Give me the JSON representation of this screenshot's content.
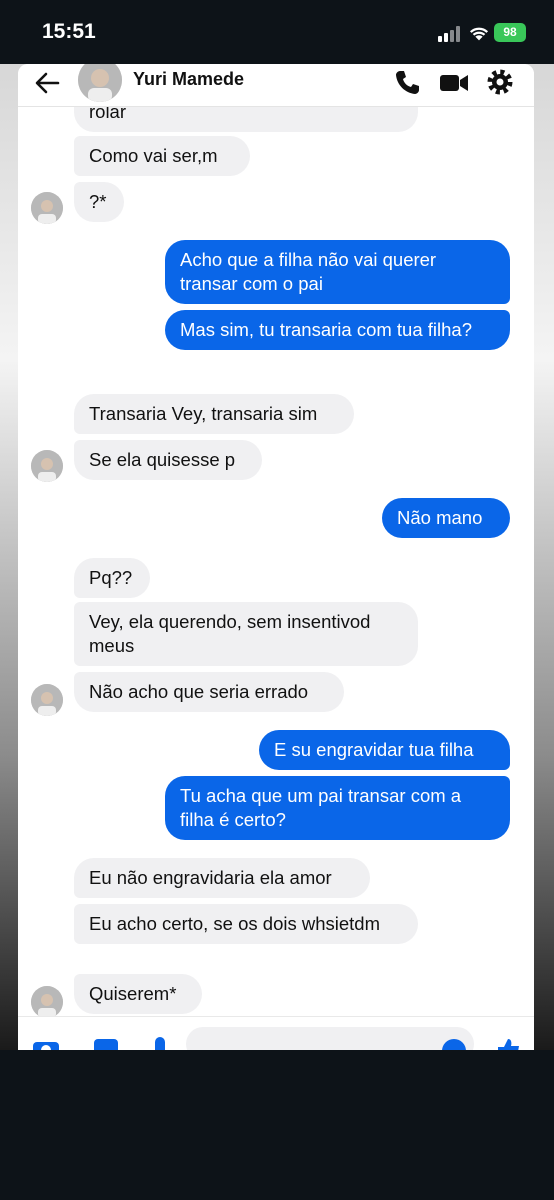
{
  "status": {
    "time": "15:51",
    "battery": "98"
  },
  "header": {
    "contact_name": "Yuri Mamede"
  },
  "messages": [
    {
      "text": "rolar"
    },
    {
      "text": "Como vai ser,m"
    },
    {
      "text": "?*"
    },
    {
      "text": "Acho que a filha não vai querer transar com o pai"
    },
    {
      "text": "Mas sim, tu transaria com tua filha?"
    },
    {
      "text": "Transaria Vey, transaria sim"
    },
    {
      "text": "Se ela quisesse p"
    },
    {
      "text": "Não mano"
    },
    {
      "text": "Pq??"
    },
    {
      "text": "Vey, ela querendo, sem insentivod meus"
    },
    {
      "text": "Não acho que seria errado"
    },
    {
      "text": "E su engravidar tua filha"
    },
    {
      "text": "Tu acha que um pai transar com a filha é certo?"
    },
    {
      "text": "Eu não engravidaria ela amor"
    },
    {
      "text": "Eu acho certo, se os dois whsietdm"
    },
    {
      "text": "Quiserem*"
    }
  ],
  "colors": {
    "outgoing": "#0a66e8",
    "incoming": "#f0f0f2",
    "battery": "#39c759"
  },
  "icons": [
    "back-arrow-icon",
    "phone-icon",
    "video-camera-icon",
    "gear-icon",
    "camera-icon",
    "image-icon",
    "microphone-icon",
    "emoji-icon",
    "like-icon"
  ]
}
